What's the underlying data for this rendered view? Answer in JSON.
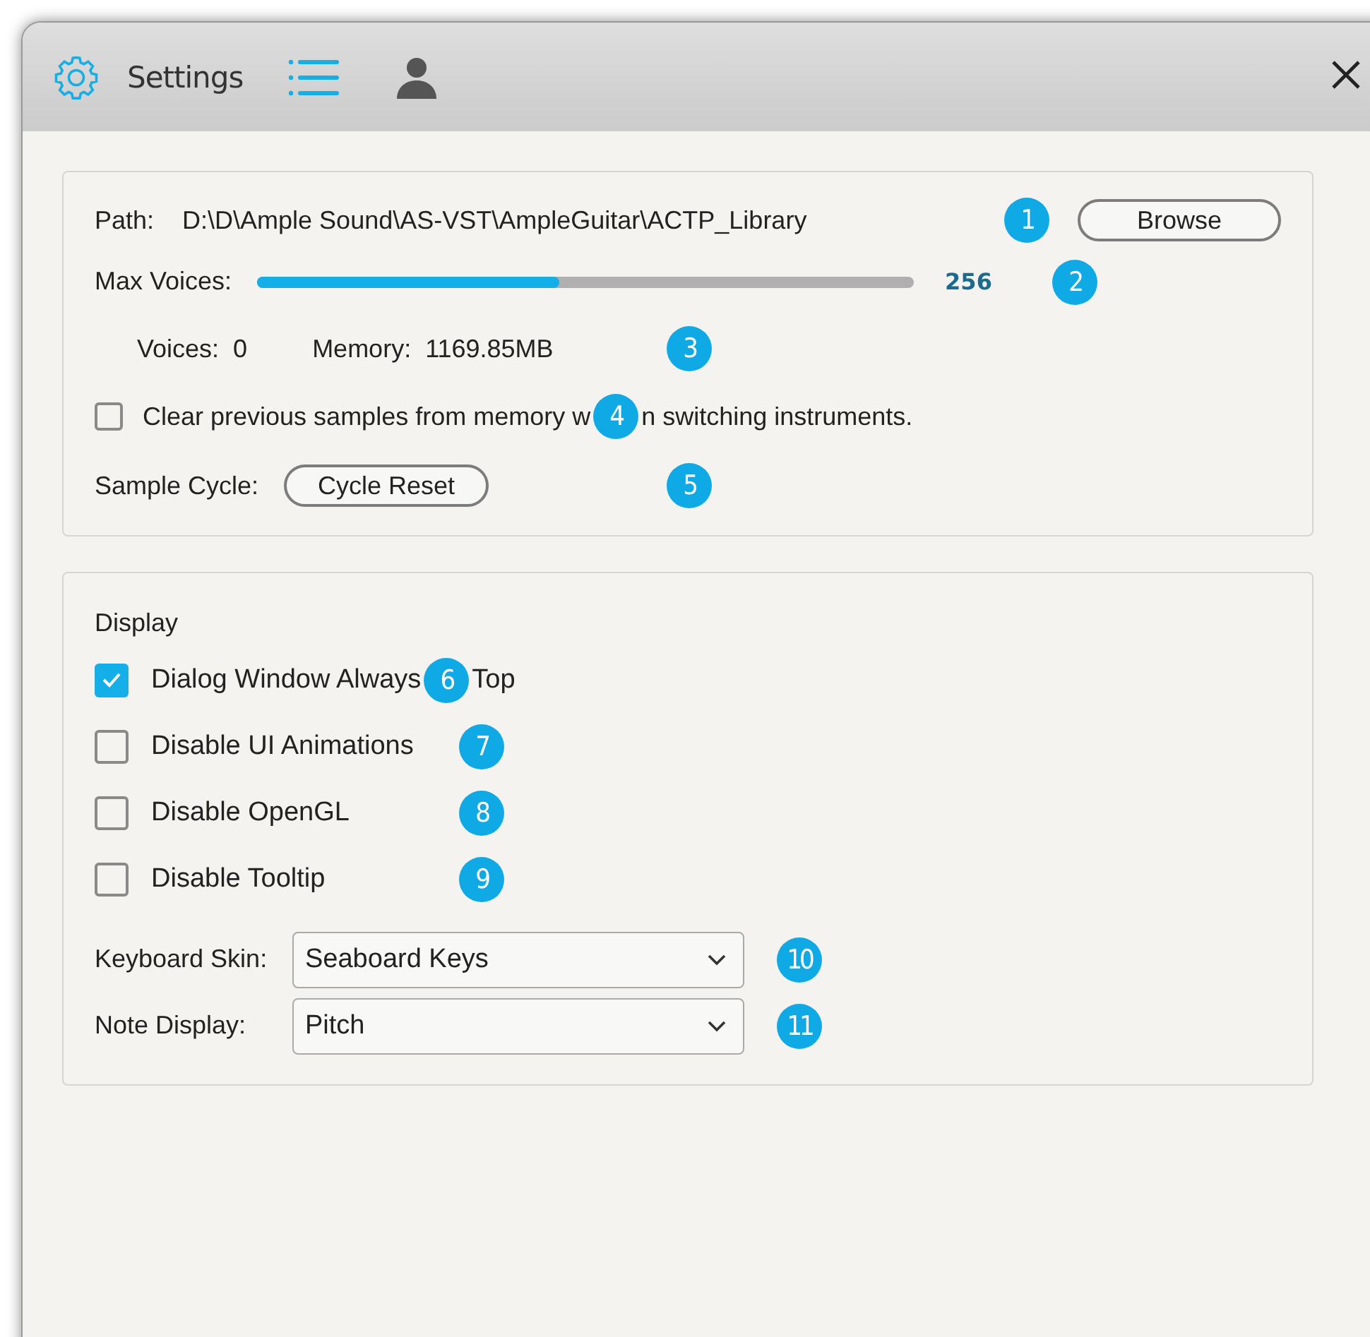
{
  "header": {
    "title": "Settings",
    "views": [
      {
        "kind": "list",
        "selected": true
      },
      {
        "kind": "user",
        "selected": false
      }
    ]
  },
  "library": {
    "path_label": "Path:",
    "path": "D:\\D\\Ample Sound\\AS-VST\\AmpleGuitar\\ACTP_Library",
    "path_badge": "1",
    "browse": "Browse",
    "max_voices_label": "Max Voices:",
    "level": 0.46,
    "reading": "256",
    "voices_badge": "2",
    "voices_label": "Voices:",
    "voices": "0",
    "memory_label": "Memory:",
    "memory": "1169.85MB",
    "stats_badge": "3",
    "clear": {
      "checked": false,
      "text_parts": [
        "Clear previous samples from memory w",
        "n switching instruments."
      ],
      "badge": "4"
    },
    "cycle_label": "Sample Cycle:",
    "cycle_button": "Cycle Reset",
    "cycle_badge": "5"
  },
  "display": {
    "title": "Display",
    "options": [
      {
        "checked": true,
        "text_parts": [
          "Dialog Window Always",
          "Top"
        ],
        "badge": "6"
      },
      {
        "checked": false,
        "text_parts": [
          "Disable UI Animations"
        ],
        "badge": "7"
      },
      {
        "checked": false,
        "text_parts": [
          "Disable OpenGL"
        ],
        "badge": "8"
      },
      {
        "checked": false,
        "text_parts": [
          "Disable Tooltip"
        ],
        "badge": "9"
      }
    ],
    "selects": [
      {
        "label": "Keyboard Skin:",
        "value": "Seaboard Keys",
        "badge": "10"
      },
      {
        "label": "Note Display:",
        "value": "Pitch",
        "badge": "11"
      }
    ]
  }
}
